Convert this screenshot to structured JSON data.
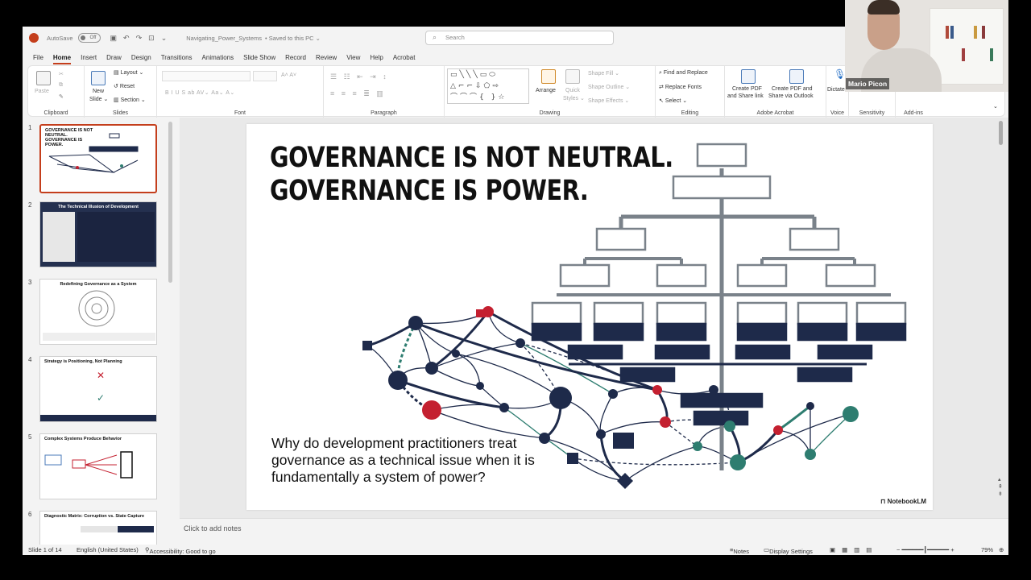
{
  "titlebar": {
    "autosave": "AutoSave",
    "toggle": "Off",
    "filename": "Navigating_Power_Systems",
    "saved": "• Saved to this PC ⌄",
    "search_placeholder": "Search"
  },
  "tabs": [
    "File",
    "Home",
    "Insert",
    "Draw",
    "Design",
    "Transitions",
    "Animations",
    "Slide Show",
    "Record",
    "Review",
    "View",
    "Help",
    "Acrobat"
  ],
  "ribbon": {
    "clipboard": {
      "paste": "Paste",
      "label": "Clipboard"
    },
    "slides": {
      "new_slide_1": "New",
      "new_slide_2": "Slide ⌄",
      "layout": "Layout ⌄",
      "reset": "Reset",
      "section": "Section ⌄",
      "label": "Slides"
    },
    "font": {
      "size": "A˄ A˅",
      "label": "Font",
      "format_row": "B   I   U   S   ab   AV⌄   Aa⌄   A⌄"
    },
    "paragraph": {
      "label": "Paragraph"
    },
    "drawing": {
      "arrange": "Arrange",
      "quick_1": "Quick",
      "quick_2": "Styles ⌄",
      "shape_fill": "Shape Fill ⌄",
      "shape_outline": "Shape Outline ⌄",
      "shape_effects": "Shape Effects ⌄",
      "label": "Drawing"
    },
    "editing": {
      "find": "Find and Replace",
      "replace": "Replace Fonts",
      "select": "Select ⌄",
      "label": "Editing"
    },
    "acrobat": {
      "create1a": "Create PDF",
      "create1b": "and Share link",
      "create2a": "Create PDF and",
      "create2b": "Share via Outlook",
      "label": "Adobe Acrobat"
    },
    "voice": {
      "dictate": "Dictate",
      "label": "Voice"
    },
    "sensitivity": {
      "label": "Sensitivity"
    },
    "addins": {
      "label": "Add-ins"
    }
  },
  "thumbnails": [
    {
      "num": "1",
      "title": "GOVERNANCE IS NOT NEUTRAL. GOVERNANCE IS POWER.",
      "selected": true
    },
    {
      "num": "2",
      "title": "The Technical Illusion of Development"
    },
    {
      "num": "3",
      "title": "Redefining Governance as a System"
    },
    {
      "num": "4",
      "title": "Strategy is Positioning, Not Planning"
    },
    {
      "num": "5",
      "title": "Complex Systems Produce Behavior"
    },
    {
      "num": "6",
      "title": "Diagnostic Matrix: Corruption vs. State Capture"
    }
  ],
  "slide": {
    "title_line1": "GOVERNANCE IS NOT NEUTRAL.",
    "title_line2": "GOVERNANCE IS POWER.",
    "question": "Why do development practitioners treat governance as a technical issue when it is fundamentally a system of power?",
    "brand": "NotebookLM",
    "colors": {
      "navy": "#1e2a4a",
      "gray": "#7a828a",
      "red": "#c42030",
      "teal": "#2e7d70"
    }
  },
  "notes": {
    "placeholder": "Click to add notes"
  },
  "status": {
    "slide": "Slide 1 of 14",
    "language": "English (United States)",
    "accessibility": "Accessibility: Good to go",
    "notes": "Notes",
    "display": "Display Settings",
    "zoom": "79%"
  },
  "video": {
    "name": "Mario Picon"
  }
}
